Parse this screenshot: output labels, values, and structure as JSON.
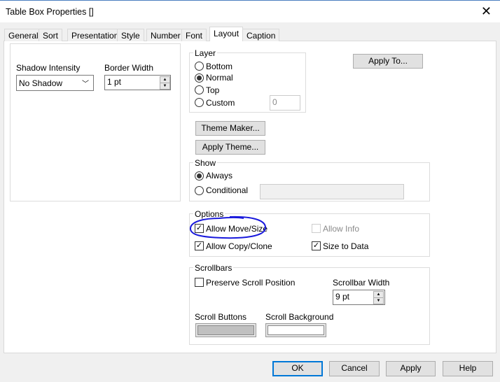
{
  "window": {
    "title": "Table Box Properties []",
    "close_icon": "close-icon"
  },
  "tabs": [
    {
      "label": "General"
    },
    {
      "label": "Sort"
    },
    {
      "label": "Presentation"
    },
    {
      "label": "Style"
    },
    {
      "label": "Number"
    },
    {
      "label": "Font"
    },
    {
      "label": "Layout",
      "active": true
    },
    {
      "label": "Caption"
    }
  ],
  "shadow": {
    "label": "Shadow Intensity",
    "value": "No Shadow"
  },
  "border": {
    "label": "Border Width",
    "value": "1 pt"
  },
  "layer": {
    "title": "Layer",
    "options": [
      "Bottom",
      "Normal",
      "Top",
      "Custom"
    ],
    "selected": "Normal",
    "custom_value": "0"
  },
  "apply_to": "Apply To...",
  "theme_maker": "Theme Maker...",
  "apply_theme": "Apply Theme...",
  "show": {
    "title": "Show",
    "always": "Always",
    "conditional": "Conditional",
    "selected": "Always"
  },
  "options": {
    "title": "Options",
    "allow_move_size": {
      "label": "Allow Move/Size",
      "checked": true
    },
    "allow_info": {
      "label": "Allow Info",
      "checked": false,
      "disabled": true
    },
    "allow_copy_clone": {
      "label": "Allow Copy/Clone",
      "checked": true
    },
    "size_to_data": {
      "label": "Size to Data",
      "checked": true
    }
  },
  "scrollbars": {
    "title": "Scrollbars",
    "preserve": {
      "label": "Preserve Scroll Position",
      "checked": false
    },
    "width_label": "Scrollbar Width",
    "width_value": "9 pt",
    "buttons_label": "Scroll Buttons",
    "buttons_color": "#c0c0c0",
    "background_label": "Scroll Background",
    "background_color": "#ffffff"
  },
  "annotation_color": "#1a1adc",
  "footer": {
    "ok": "OK",
    "cancel": "Cancel",
    "apply": "Apply",
    "help": "Help"
  }
}
